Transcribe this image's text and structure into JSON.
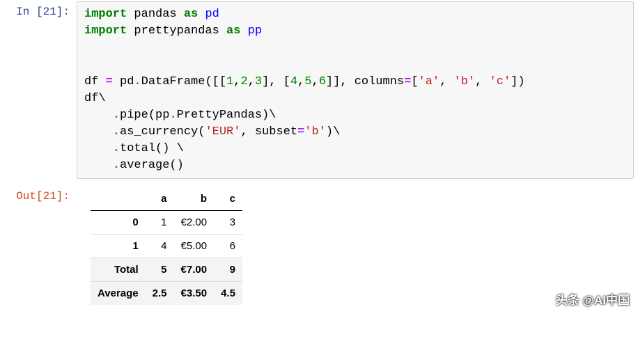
{
  "input": {
    "prompt": "In [21]:",
    "code_tokens": [
      {
        "t": "import",
        "c": "kw"
      },
      {
        "t": " pandas ",
        "c": "pln"
      },
      {
        "t": "as",
        "c": "kw"
      },
      {
        "t": " pd",
        "c": "nn"
      },
      {
        "t": "\n",
        "c": "pln"
      },
      {
        "t": "import",
        "c": "kw"
      },
      {
        "t": " prettypandas ",
        "c": "pln"
      },
      {
        "t": "as",
        "c": "kw"
      },
      {
        "t": " pp",
        "c": "nn"
      },
      {
        "t": "\n\n\n",
        "c": "pln"
      },
      {
        "t": "df ",
        "c": "pln"
      },
      {
        "t": "=",
        "c": "op"
      },
      {
        "t": " pd",
        "c": "pln"
      },
      {
        "t": ".",
        "c": "op"
      },
      {
        "t": "DataFrame([[",
        "c": "pln"
      },
      {
        "t": "1",
        "c": "num"
      },
      {
        "t": ",",
        "c": "pln"
      },
      {
        "t": "2",
        "c": "num"
      },
      {
        "t": ",",
        "c": "pln"
      },
      {
        "t": "3",
        "c": "num"
      },
      {
        "t": "], [",
        "c": "pln"
      },
      {
        "t": "4",
        "c": "num"
      },
      {
        "t": ",",
        "c": "pln"
      },
      {
        "t": "5",
        "c": "num"
      },
      {
        "t": ",",
        "c": "pln"
      },
      {
        "t": "6",
        "c": "num"
      },
      {
        "t": "]], columns",
        "c": "pln"
      },
      {
        "t": "=",
        "c": "op"
      },
      {
        "t": "[",
        "c": "pln"
      },
      {
        "t": "'a'",
        "c": "str"
      },
      {
        "t": ", ",
        "c": "pln"
      },
      {
        "t": "'b'",
        "c": "str"
      },
      {
        "t": ", ",
        "c": "pln"
      },
      {
        "t": "'c'",
        "c": "str"
      },
      {
        "t": "])",
        "c": "pln"
      },
      {
        "t": "\n",
        "c": "pln"
      },
      {
        "t": "df\\",
        "c": "pln"
      },
      {
        "t": "\n",
        "c": "pln"
      },
      {
        "t": "    ",
        "c": "pln"
      },
      {
        "t": ".",
        "c": "op"
      },
      {
        "t": "pipe(pp",
        "c": "pln"
      },
      {
        "t": ".",
        "c": "op"
      },
      {
        "t": "PrettyPandas)\\",
        "c": "pln"
      },
      {
        "t": "\n",
        "c": "pln"
      },
      {
        "t": "    ",
        "c": "pln"
      },
      {
        "t": ".",
        "c": "op"
      },
      {
        "t": "as_currency(",
        "c": "pln"
      },
      {
        "t": "'EUR'",
        "c": "str"
      },
      {
        "t": ", subset",
        "c": "pln"
      },
      {
        "t": "=",
        "c": "op"
      },
      {
        "t": "'b'",
        "c": "str"
      },
      {
        "t": ")\\",
        "c": "pln"
      },
      {
        "t": "\n",
        "c": "pln"
      },
      {
        "t": "    ",
        "c": "pln"
      },
      {
        "t": ".",
        "c": "op"
      },
      {
        "t": "total() \\",
        "c": "pln"
      },
      {
        "t": "\n",
        "c": "pln"
      },
      {
        "t": "    ",
        "c": "pln"
      },
      {
        "t": ".",
        "c": "op"
      },
      {
        "t": "average()",
        "c": "pln"
      }
    ]
  },
  "output": {
    "prompt": "Out[21]:",
    "table": {
      "columns": [
        "",
        "a",
        "b",
        "c"
      ],
      "rows": [
        {
          "idx": "0",
          "a": "1",
          "b": "€2.00",
          "c": "3",
          "summary": false
        },
        {
          "idx": "1",
          "a": "4",
          "b": "€5.00",
          "c": "6",
          "summary": false
        },
        {
          "idx": "Total",
          "a": "5",
          "b": "€7.00",
          "c": "9",
          "summary": true
        },
        {
          "idx": "Average",
          "a": "2.5",
          "b": "€3.50",
          "c": "4.5",
          "summary": true
        }
      ]
    }
  },
  "watermark": "头条 @AI中国"
}
